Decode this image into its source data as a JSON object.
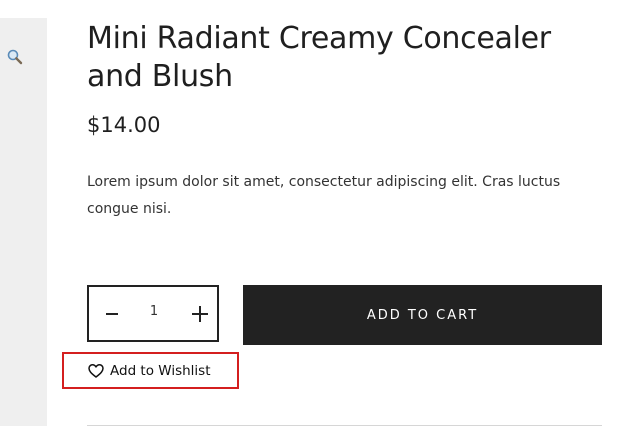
{
  "gallery": {
    "zoom_icon": "magnifier-icon"
  },
  "product": {
    "title": "Mini Radiant Creamy Concealer and Blush",
    "price": "$14.00",
    "description": "Lorem ipsum dolor sit amet, consectetur adipiscing elit. Cras luctus congue nisi."
  },
  "cart": {
    "quantity": "1",
    "minus_icon": "minus-icon",
    "plus_icon": "plus-icon",
    "add_to_cart_label": "ADD TO CART"
  },
  "wishlist": {
    "icon": "heart-icon",
    "label": "Add to Wishlist",
    "highlight_color": "#d41f1f"
  },
  "colors": {
    "button_bg": "#222222",
    "gallery_bg": "#efefef"
  }
}
